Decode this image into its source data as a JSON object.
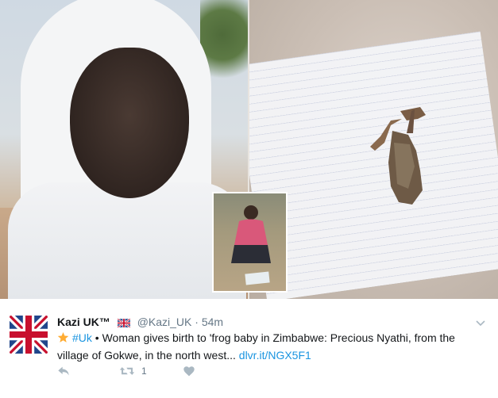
{
  "tweet": {
    "author_name": "Kazi UK™",
    "handle": "@Kazi_UK",
    "separator": "·",
    "time": "54m",
    "hashtag": "#Uk",
    "text_after_hashtag": " • Woman gives birth to 'frog baby in Zimbabwe: Precious Nyathi, from the village of Gokwe, in the north west... ",
    "link_text": "dlvr.it/NGX5F1",
    "retweet_count": "1"
  },
  "icons": {
    "avatar": "union-jack-flag",
    "name_flag": "union-jack-flag-icon",
    "star": "star-icon",
    "caret": "chevron-down-icon",
    "reply": "reply-icon",
    "retweet": "retweet-icon",
    "like": "heart-icon"
  },
  "colors": {
    "link": "#1b95e0",
    "muted": "#657786",
    "action_icon": "#aab8c2",
    "star": "#ffac33"
  }
}
